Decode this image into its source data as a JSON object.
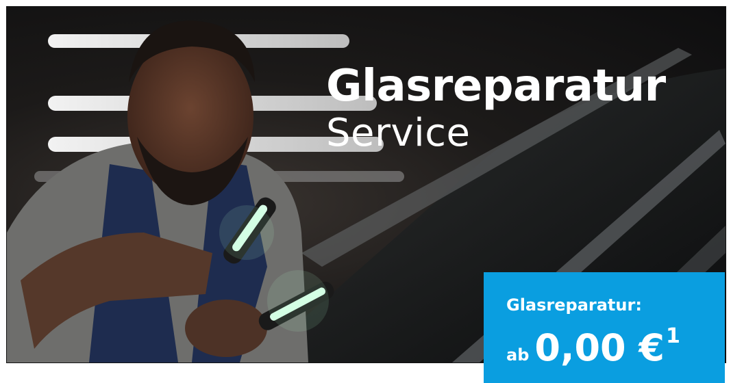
{
  "headline": {
    "title": "Glasreparatur",
    "subtitle": "Service"
  },
  "price_box": {
    "label": "Glasreparatur:",
    "prefix": "ab",
    "value": "0,00 €",
    "footnote": "1",
    "background": "#0a9ee0"
  },
  "image": {
    "subject": "technician-inspecting-windshield"
  }
}
